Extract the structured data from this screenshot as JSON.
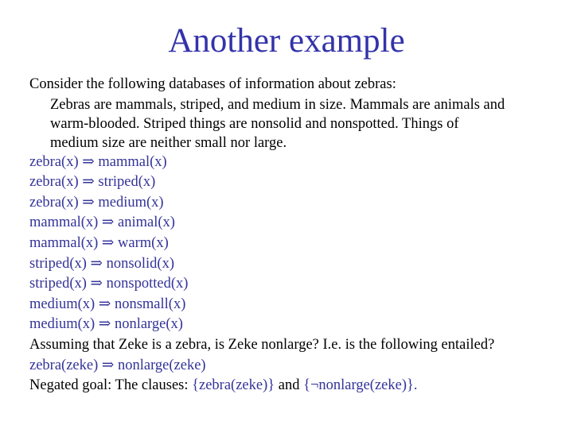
{
  "slide": {
    "title": "Another example"
  },
  "intro": "Consider the following databases of information about zebras:",
  "description_lines": [
    "Zebras are mammals, striped, and medium in size. Mammals are animals and",
    "warm-blooded. Striped things are nonsolid and nonspotted. Things of",
    "medium size are neither small nor large."
  ],
  "rules": [
    "zebra(x) ⇒ mammal(x)",
    "zebra(x) ⇒ striped(x)",
    "zebra(x) ⇒ medium(x)",
    "mammal(x) ⇒ animal(x)",
    "mammal(x) ⇒ warm(x)",
    "striped(x) ⇒ nonsolid(x)",
    "striped(x) ⇒ nonspotted(x)",
    "medium(x) ⇒ nonsmall(x)",
    "medium(x) ⇒ nonlarge(x)"
  ],
  "question": "Assuming that Zeke is a zebra, is Zeke nonlarge? I.e. is the following entailed?",
  "goal": "zebra(zeke) ⇒ nonlarge(zeke)",
  "negated": {
    "label": "Negated goal: The clauses: ",
    "clause1": "{zebra(zeke)}",
    "connector": " and ",
    "clause2": "{¬nonlarge(zeke)}",
    "end": "."
  },
  "colors": {
    "title": "#3333aa",
    "formula": "#333399",
    "text": "#000000"
  }
}
